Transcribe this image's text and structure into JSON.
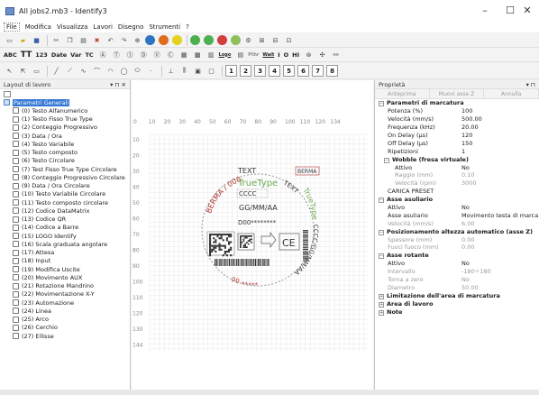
{
  "window": {
    "title": "All jobs2.mb3 - Identify3",
    "minimize": "–",
    "maximize": "☐",
    "close": "✕"
  },
  "menu": [
    "File",
    "Modifica",
    "Visualizza",
    "Lavori",
    "Disegno",
    "Strumenti",
    "?"
  ],
  "toolbar2_labels": [
    "ABC",
    "TT",
    "123",
    "Date",
    "Var",
    "TC",
    "Logo",
    "Pthr",
    "Wait",
    "I",
    "O",
    "HI"
  ],
  "toolbar3_numbers": [
    "1",
    "2",
    "3",
    "4",
    "5",
    "6",
    "7",
    "8"
  ],
  "layout_panel": {
    "title": "Layout di lavoro",
    "pin": "▾ ⊓ ✕",
    "items": [
      "Parametri Generali",
      "(0) Testo Alfanumerico",
      "(1) Testo Fisso True Type",
      "(2) Conteggio Progressivo",
      "(3) Data / Ora",
      "(4) Testo Variabile",
      "(5) Testo composto",
      "(6) Testo Circolare",
      "(7) Test Fisso True Type Circolare",
      "(8) Conteggio Progressivo Circolare",
      "(9) Data / Ora Circolare",
      "(10) Testo Variabile Circolare",
      "(11) Testo composto circolare",
      "(12) Codice DataMatrix",
      "(13) Codice QR",
      "(14) Codice a Barre",
      "(15) LOGO Identify",
      "(16) Scala graduata angolare",
      "(17) Attesa",
      "(18) Input",
      "(19) Modifica Uscite",
      "(20) Movimento AUX",
      "(21) Rotazione Mandrino",
      "(22) Movimentazione X-Y",
      "(23) Automazione",
      "(24) Linea",
      "(25) Arco",
      "(26) Cerchio",
      "(27) Ellisse"
    ]
  },
  "canvas": {
    "ruler_top": [
      "0",
      "10",
      "20",
      "30",
      "40",
      "50",
      "60",
      "70",
      "80",
      "90",
      "100",
      "110",
      "120",
      "134"
    ],
    "ruler_left": [
      "10",
      "20",
      "30",
      "40",
      "50",
      "60",
      "70",
      "80",
      "90",
      "100",
      "110",
      "120",
      "130",
      "144"
    ],
    "texts": {
      "text_box": "TEXT",
      "truetype": "TrueType",
      "cccc": "CCCC",
      "date": "GG/MM/AA",
      "counter": "D00********",
      "berma_box": "BERMA",
      "circ_left": "BERMA / 000",
      "circ_right_top": "TEXT",
      "circ_right": "TrueType",
      "circ_bottom_right": "CCCC/GG/MM/AA",
      "circ_bottom_left": "***** 00",
      "ce": "CE"
    }
  },
  "properties": {
    "title": "Proprietà",
    "pin": "▾ ⊓",
    "tabs": [
      "Anteprima",
      "Muovi asse Z",
      "Annulla"
    ],
    "rows": [
      {
        "type": "sect",
        "label": "Parametri di marcatura"
      },
      {
        "label": "Potenza (%)",
        "value": "100"
      },
      {
        "label": "Velocità (mm/s)",
        "value": "500.00"
      },
      {
        "label": "Frequenza (kHz)",
        "value": "20.00"
      },
      {
        "label": "On Delay (µs)",
        "value": "120"
      },
      {
        "label": "Off Delay (µs)",
        "value": "150"
      },
      {
        "label": "Ripetizioni",
        "value": "1"
      },
      {
        "type": "sub",
        "label": "Wobble (fresa virtuale)"
      },
      {
        "type": "sub2",
        "label": "Attivo",
        "value": "No"
      },
      {
        "type": "sub2",
        "dim": true,
        "label": "Raggio (mm)",
        "value": "0.10"
      },
      {
        "type": "sub2",
        "dim": true,
        "label": "Velocità (rpm)",
        "value": "3000"
      },
      {
        "label": "CARICA PRESET",
        "value": ""
      },
      {
        "type": "sect",
        "label": "Asse asuliario"
      },
      {
        "label": "Attivo",
        "value": "No"
      },
      {
        "label": "Asse asuliario",
        "value": "Movimento testa di marca..."
      },
      {
        "dim": true,
        "label": "Velocità (mm/s)",
        "value": "6.00"
      },
      {
        "type": "sect",
        "label": "Posizionamento altezza automatico  (asse Z)"
      },
      {
        "dim": true,
        "label": "Spessore (mm)",
        "value": "0.00"
      },
      {
        "dim": true,
        "label": "Fuoci fuoco (mm)",
        "value": "0.00"
      },
      {
        "type": "sect",
        "label": "Asse rotante"
      },
      {
        "label": "Attivo",
        "value": "No"
      },
      {
        "dim": true,
        "label": "Intervallo",
        "value": "-180÷180"
      },
      {
        "dim": true,
        "label": "Torna a zero",
        "value": "No"
      },
      {
        "dim": true,
        "label": "Diametro",
        "value": "50.00"
      },
      {
        "type": "sect",
        "collapsed": true,
        "label": "Limitazione dell'area di marcatura"
      },
      {
        "type": "sect",
        "collapsed": true,
        "label": "Area di lavoro"
      },
      {
        "type": "sect",
        "collapsed": true,
        "label": "Note"
      }
    ]
  },
  "colors": {
    "selection": "#3478d4",
    "mark_green": "#6aa84f",
    "mark_red": "#b03030"
  }
}
